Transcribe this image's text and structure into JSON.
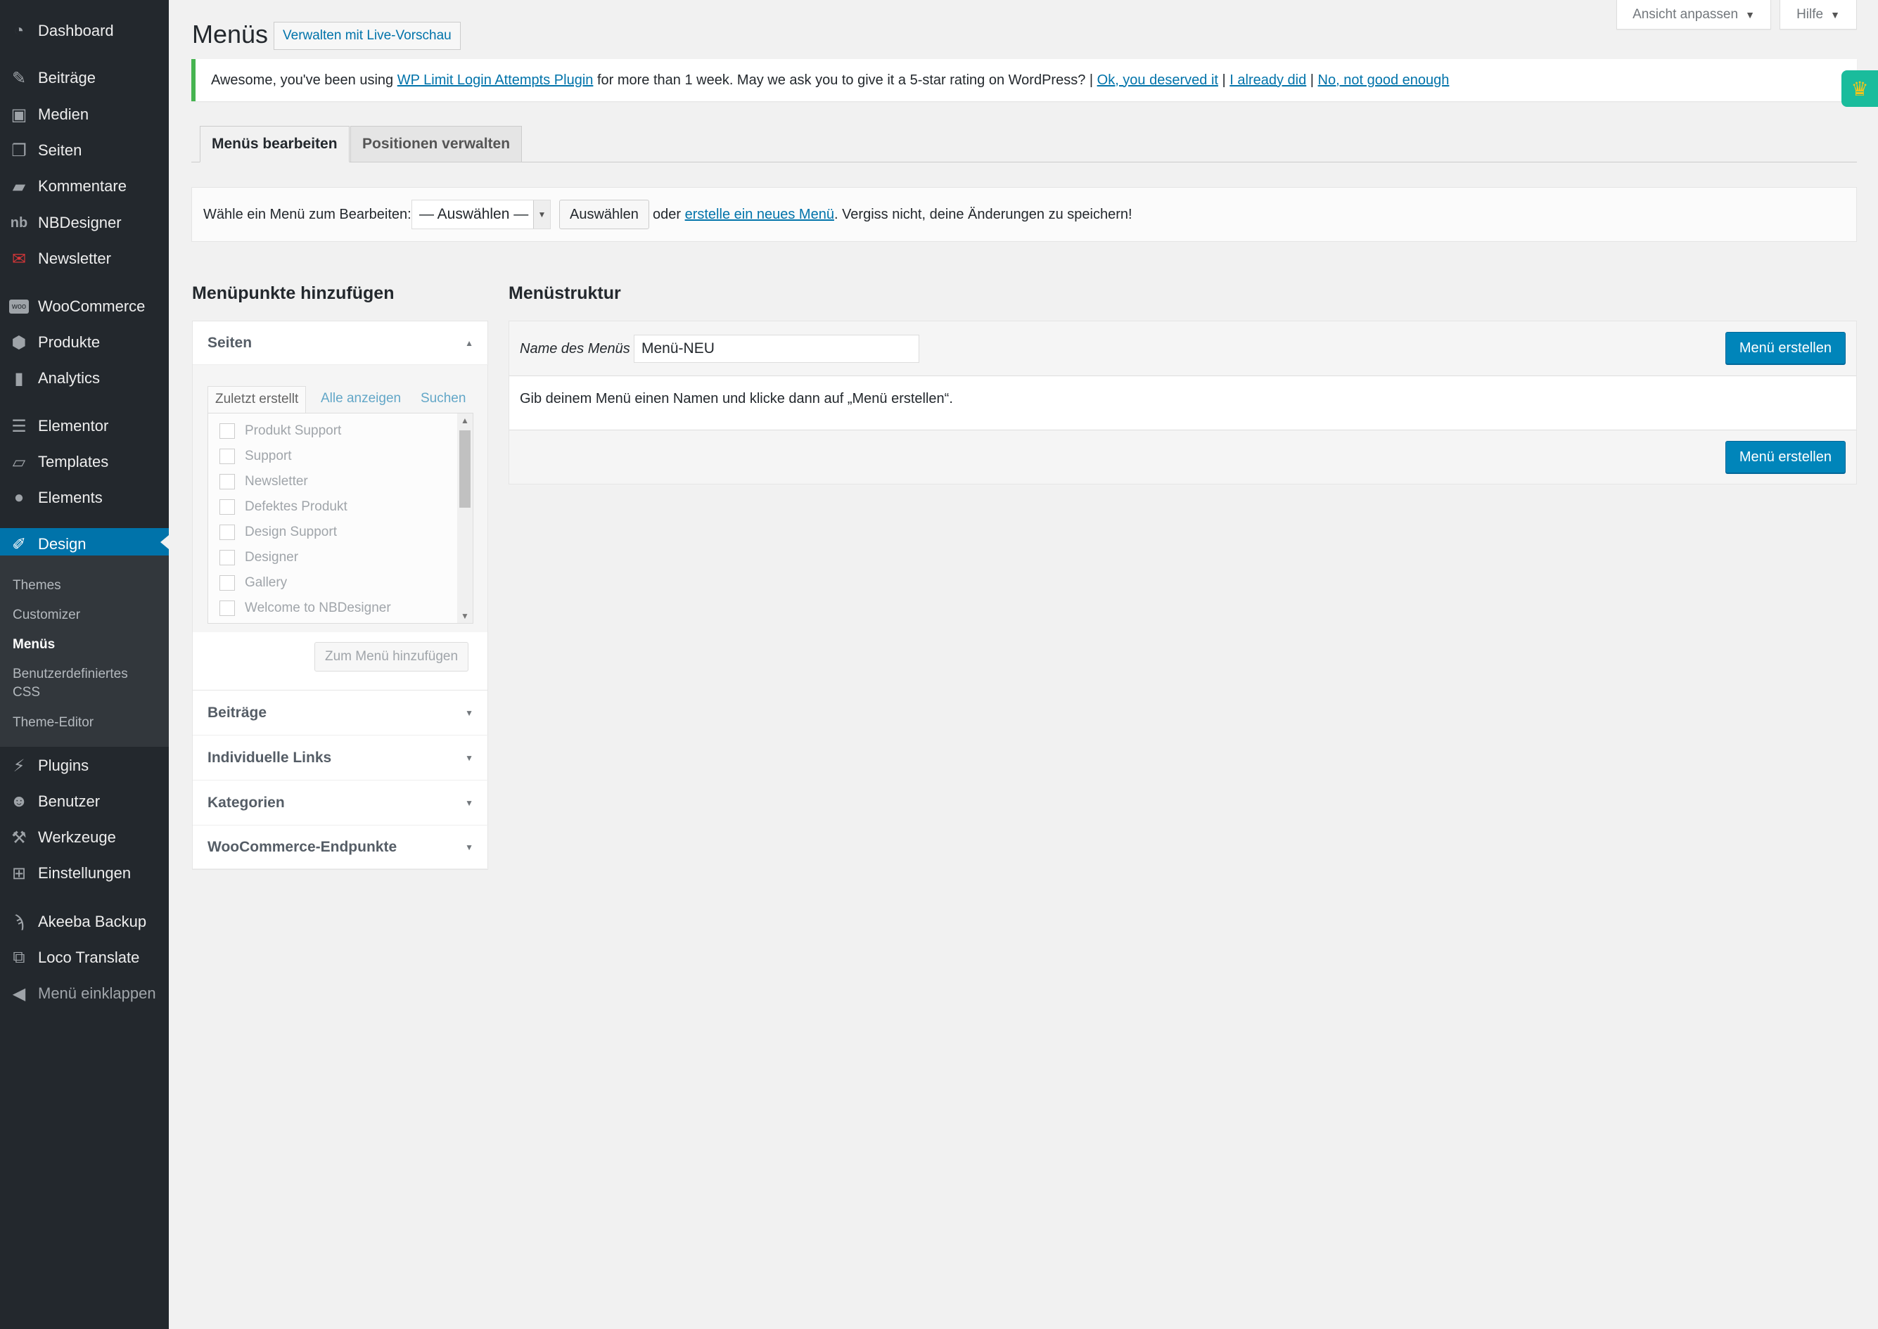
{
  "sidebar": {
    "items": [
      {
        "label": "Dashboard",
        "icon": "dashboard-icon"
      },
      {
        "label": "Beiträge",
        "icon": "pin-icon"
      },
      {
        "label": "Medien",
        "icon": "media-icon"
      },
      {
        "label": "Seiten",
        "icon": "pages-icon"
      },
      {
        "label": "Kommentare",
        "icon": "comment-icon"
      },
      {
        "label": "NBDesigner",
        "icon": "nbdesigner-icon"
      },
      {
        "label": "Newsletter",
        "icon": "newsletter-icon"
      },
      {
        "label": "WooCommerce",
        "icon": "woocommerce-icon"
      },
      {
        "label": "Produkte",
        "icon": "box-icon"
      },
      {
        "label": "Analytics",
        "icon": "bar-chart-icon"
      },
      {
        "label": "Elementor",
        "icon": "elementor-icon"
      },
      {
        "label": "Templates",
        "icon": "folder-icon"
      },
      {
        "label": "Elements",
        "icon": "leaf-icon"
      },
      {
        "label": "Design",
        "icon": "paintbrush-icon"
      },
      {
        "label": "Plugins",
        "icon": "plugin-icon"
      },
      {
        "label": "Benutzer",
        "icon": "user-icon"
      },
      {
        "label": "Werkzeuge",
        "icon": "wrench-icon"
      },
      {
        "label": "Einstellungen",
        "icon": "settings-icon"
      },
      {
        "label": "Akeeba Backup",
        "icon": "akeeba-icon"
      },
      {
        "label": "Loco Translate",
        "icon": "translate-icon"
      },
      {
        "label": "Menü einklappen",
        "icon": "collapse-icon"
      }
    ],
    "submenu": [
      "Themes",
      "Customizer",
      "Menüs",
      "Benutzerdefiniertes CSS",
      "Theme-Editor"
    ]
  },
  "screen_meta": {
    "view_label": "Ansicht anpassen",
    "help_label": "Hilfe"
  },
  "header": {
    "title": "Menüs",
    "live_preview": "Verwalten mit Live-Vorschau"
  },
  "notice": {
    "prefix": "Awesome, you've been using ",
    "plugin_link": "WP Limit Login Attempts Plugin",
    "middle": " for more than 1 week. May we ask you to give it a 5-star rating on WordPress? | ",
    "link_ok": "Ok, you deserved it",
    "sep1": " | ",
    "link_already": "I already did",
    "sep2": " | ",
    "link_no": "No, not good enough"
  },
  "tabs": {
    "edit": "Menüs bearbeiten",
    "locations": "Positionen verwalten"
  },
  "select_bar": {
    "label": "Wähle ein Menü zum Bearbeiten:",
    "selected": "— Auswählen —",
    "button": "Auswählen",
    "or": "oder ",
    "create_link": "erstelle ein neues Menü",
    "tail": ". Vergiss nicht, deine Änderungen zu speichern!"
  },
  "left": {
    "heading": "Menüpunkte hinzufügen",
    "seiten": {
      "title": "Seiten",
      "tabs": [
        "Zuletzt erstellt",
        "Alle anzeigen",
        "Suchen"
      ],
      "pages": [
        "Produkt Support",
        "Support",
        "Newsletter",
        "Defektes Produkt",
        "Design Support",
        "Designer",
        "Gallery",
        "Welcome to NBDesigner"
      ],
      "add_button": "Zum Menü hinzufügen"
    },
    "sections": [
      "Beiträge",
      "Individuelle Links",
      "Kategorien",
      "WooCommerce-Endpunkte"
    ]
  },
  "right": {
    "heading": "Menüstruktur",
    "name_label": "Name des Menüs",
    "name_value": "Menü-NEU",
    "create_button": "Menü erstellen",
    "message": "Gib deinem Menü einen Namen und klicke dann auf „Menü erstellen“."
  },
  "colors": {
    "accent": "#0073aa",
    "primary_button": "#0085ba",
    "sidebar": "#23282d",
    "notice_border": "#46b450",
    "crown_tab": "#1abc9c"
  }
}
